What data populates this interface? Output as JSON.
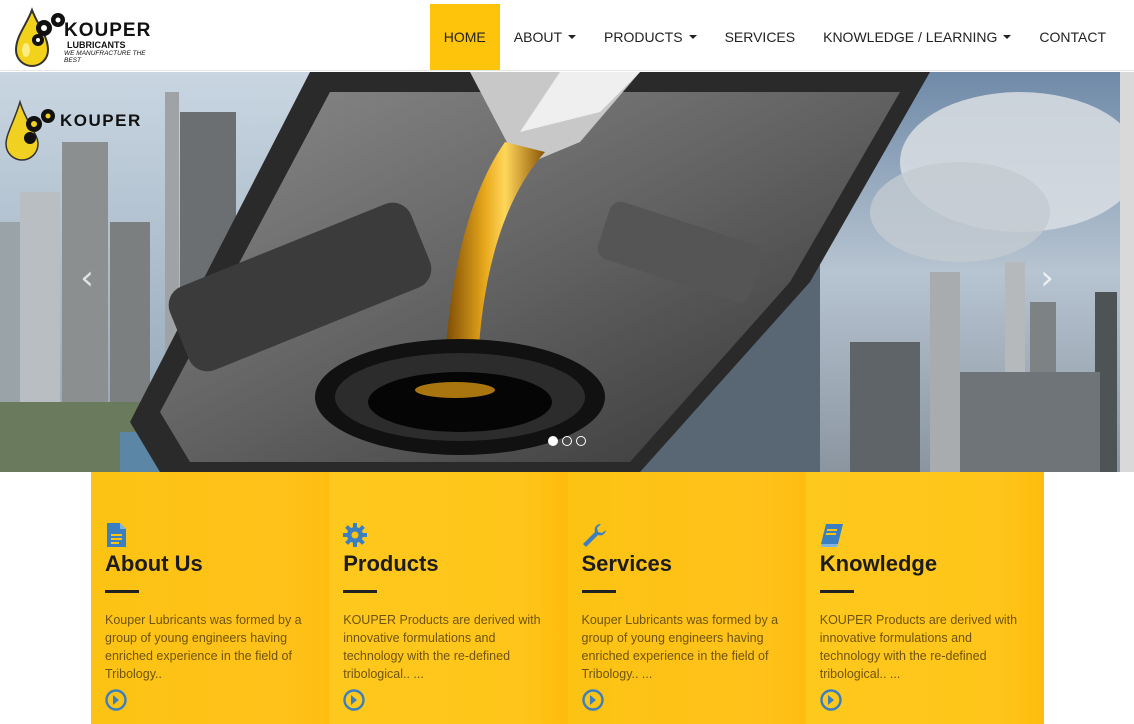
{
  "brand": {
    "name": "KOUPER",
    "subtitle": "LUBRICANTS",
    "tagline": "WE MANUFRACTURE THE BEST"
  },
  "nav": {
    "items": [
      {
        "label": "HOME",
        "active": true,
        "dropdown": false
      },
      {
        "label": "ABOUT",
        "active": false,
        "dropdown": true
      },
      {
        "label": "PRODUCTS",
        "active": false,
        "dropdown": true
      },
      {
        "label": "SERVICES",
        "active": false,
        "dropdown": false
      },
      {
        "label": "KNOWLEDGE / LEARNING",
        "active": false,
        "dropdown": true
      },
      {
        "label": "CONTACT",
        "active": false,
        "dropdown": false
      }
    ]
  },
  "hero": {
    "overlay_logo_text": "KOUPER",
    "prev_icon": "chevron-left-icon",
    "next_icon": "chevron-right-icon",
    "slide_count": 3,
    "active_slide": 1
  },
  "cards": [
    {
      "icon": "document-icon",
      "title": "About Us",
      "text": "Kouper Lubricants was formed by a group of young engineers having enriched experience in the field of Tribology..",
      "more_icon": "arrow-circle-right-icon"
    },
    {
      "icon": "gear-icon",
      "title": "Products",
      "text": "KOUPER Products are derived with innovative formulations and technology with the re-defined tribological.. ...",
      "more_icon": "arrow-circle-right-icon"
    },
    {
      "icon": "wrench-icon",
      "title": "Services",
      "text": "Kouper Lubricants was formed by a group of young engineers having enriched experience in the field of Tribology.. ...",
      "more_icon": "arrow-circle-right-icon"
    },
    {
      "icon": "book-icon",
      "title": "Knowledge",
      "text": "KOUPER Products are derived with innovative formulations and technology with the re-defined tribological.. ...",
      "more_icon": "arrow-circle-right-icon"
    }
  ],
  "colors": {
    "accent": "#fec40c",
    "icon_blue": "#3a7fc1",
    "card_text": "#6e5410"
  }
}
